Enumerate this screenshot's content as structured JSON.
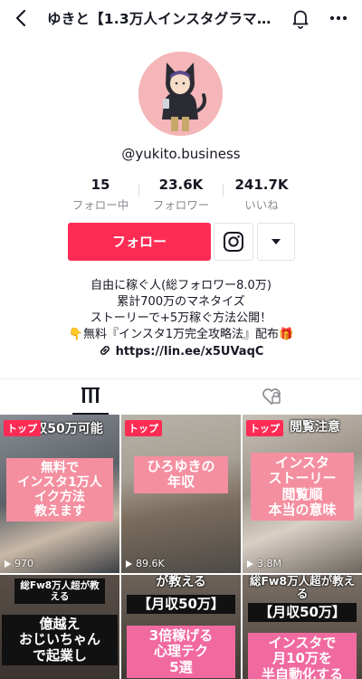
{
  "header": {
    "title": "ゆきと【1.3万人インスタグラマ…",
    "back_icon": "back-arrow-icon",
    "bell_icon": "bell-icon",
    "more_icon": "more-dots-icon"
  },
  "profile": {
    "username": "@yukito.business",
    "stats": [
      {
        "value": "15",
        "label": "フォロー中"
      },
      {
        "value": "23.6K",
        "label": "フォロワー"
      },
      {
        "value": "241.7K",
        "label": "いいね"
      }
    ],
    "follow_label": "フォロー",
    "bio_lines": [
      "自由に稼ぐ人(総フォロワー8.0万)",
      "累計700万のマネタイズ",
      "ストーリーで+5万稼ぐ方法公開！",
      "👇無料『インスタ1万完全攻略法』配布🎁"
    ],
    "link": "https://lin.ee/x5UVaqC"
  },
  "colors": {
    "accent": "#fe2c55",
    "caption_pink": "#f48fa0",
    "muted": "#8a8b91"
  },
  "videos": [
    {
      "badge": "トップ",
      "top_text": "月収50万可能",
      "main_text": [
        "無料で",
        "インスタ1万人",
        "イク方法",
        "教えます"
      ],
      "views": "970"
    },
    {
      "badge": "トップ",
      "main_text": [
        "ひろゆきの",
        "年収"
      ],
      "views": "89.6K"
    },
    {
      "badge": "トップ",
      "top_text": "閲覧注意",
      "main_text": [
        "インスタ",
        "ストーリー",
        "閲覧順",
        "本当の意味"
      ],
      "views": "3.8M"
    },
    {
      "top_text": "総Fw8万人超が教える",
      "main_text": [
        "億越え",
        "おじいちゃん",
        "で起業し"
      ]
    },
    {
      "top_text": "が教える",
      "sub_text": "【月収50万】",
      "main_text": [
        "3倍稼げる",
        "心理テク",
        "5選"
      ]
    },
    {
      "top_text": "総Fw8万人超が教える",
      "sub_text": "【月収50万】",
      "main_text": [
        "インスタで",
        "月10万を",
        "半自動化する"
      ]
    }
  ]
}
